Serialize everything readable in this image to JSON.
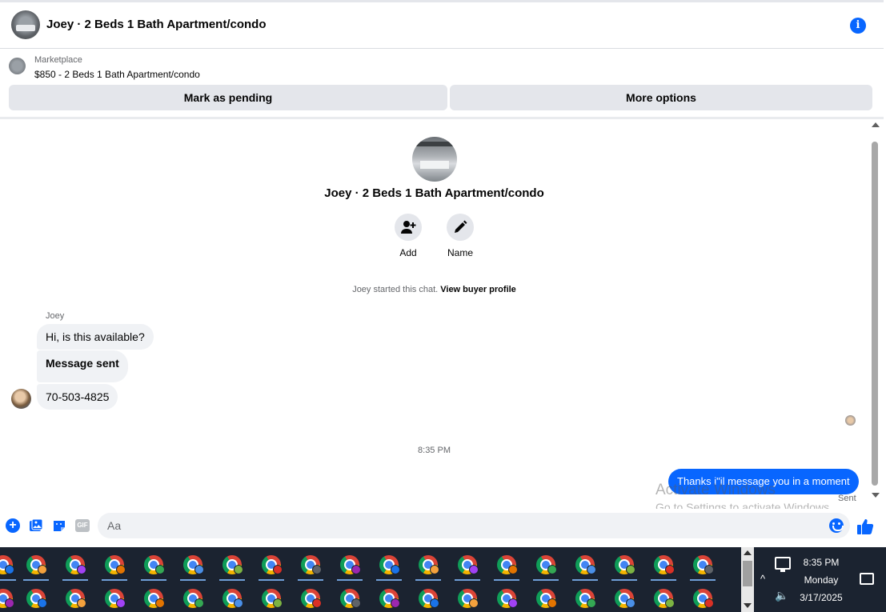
{
  "header": {
    "title": "Joey · 2 Beds 1 Bath Apartment/condo"
  },
  "marketplace": {
    "label": "Marketplace",
    "listing": "$850 - 2 Beds 1 Bath Apartment/condo"
  },
  "buttons": {
    "pending": "Mark as pending",
    "more": "More options"
  },
  "chat": {
    "title": "Joey · 2 Beds 1 Bath Apartment/condo",
    "actions": {
      "add": "Add",
      "name": "Name"
    },
    "started_text": "Joey started this chat.",
    "started_link": "View buyer profile",
    "sender": "Joey",
    "messages": [
      "Hi, is this available?",
      "Message sent",
      "70-503-4825"
    ],
    "timestamp": "8:35 PM",
    "my_message": "Thanks i\"il message you in a moment",
    "status": "Sent"
  },
  "watermark": {
    "line1": "Activate Windows",
    "line2": "Go to Settings to activate Windows."
  },
  "composer": {
    "placeholder": "Aa",
    "gif": "GIF"
  },
  "taskbar": {
    "time": "8:35 PM",
    "day": "Monday",
    "date": "3/17/2025",
    "icon": "chrome-icon"
  },
  "colors": {
    "accent": "#0866ff",
    "bubble_gray": "#f0f2f5",
    "button_gray": "#e4e6eb",
    "taskbar": "#1b2330"
  }
}
